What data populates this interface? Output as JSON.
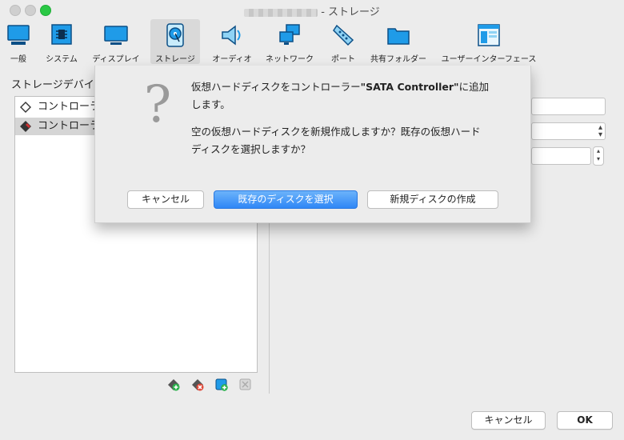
{
  "window": {
    "title_suffix": "- ストレージ"
  },
  "toolbar": {
    "items": [
      {
        "label": "一般",
        "icon": "monitor-icon"
      },
      {
        "label": "システム",
        "icon": "chip-icon"
      },
      {
        "label": "ディスプレイ",
        "icon": "display-icon"
      },
      {
        "label": "ストレージ",
        "icon": "hard-disk-icon",
        "active": true
      },
      {
        "label": "オーディオ",
        "icon": "speaker-icon"
      },
      {
        "label": "ネットワーク",
        "icon": "network-icon"
      },
      {
        "label": "ポート",
        "icon": "serial-port-icon"
      },
      {
        "label": "共有フォルダー",
        "icon": "folder-icon"
      },
      {
        "label": "ユーザーインターフェース",
        "icon": "window-layout-icon"
      }
    ]
  },
  "storage": {
    "devices_label": "ストレージデバイス",
    "tree": [
      {
        "label": "コントローラー: IDE",
        "selected": false
      },
      {
        "label": "コントローラー: SATA",
        "selected": true
      }
    ]
  },
  "dialog": {
    "line1_pre": "仮想ハードディスクをコントローラー",
    "line1_bold": "\"SATA Controller\"",
    "line1_post": "に追加",
    "line2": "します。",
    "line3": "空の仮想ハードディスクを新規作成しますか？既存の仮想ハード",
    "line4": "ディスクを選択しますか？",
    "cancel": "キャンセル",
    "choose_existing": "既存のディスクを選択",
    "create_new": "新規ディスクの作成"
  },
  "footer": {
    "cancel": "キャンセル",
    "ok": "OK"
  },
  "colors": {
    "accent_blue": "#2f87f6",
    "traffic_green": "#2ac845",
    "icon_blue": "#1d8fe0"
  }
}
